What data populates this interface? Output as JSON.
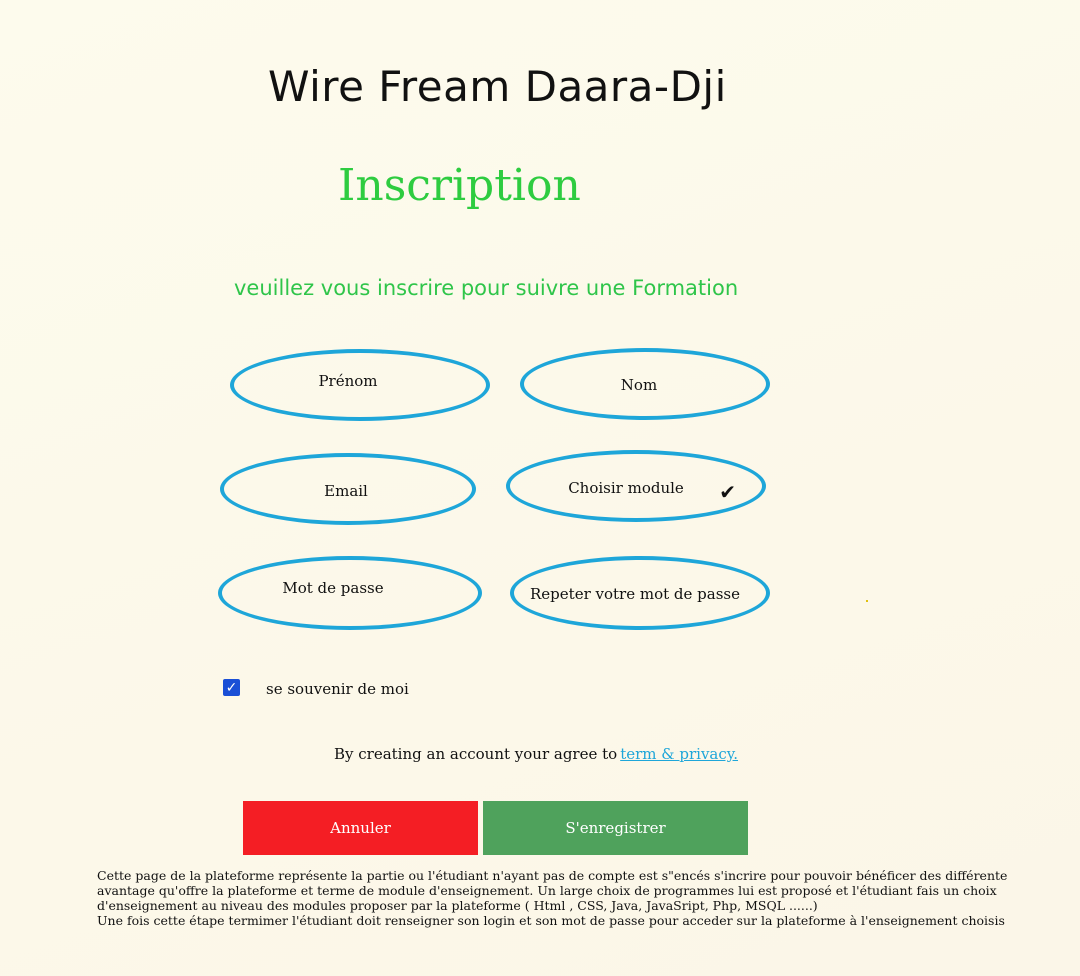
{
  "app_title": "Wire Fream Daara-Dji",
  "heading": "Inscription",
  "subtitle": "veuillez vous inscrire pour suivre une Formation",
  "fields": {
    "prenom": "Prénom",
    "nom": "Nom",
    "email": "Email",
    "module": "Choisir module",
    "password": "Mot de passe",
    "repeat_password": "Repeter votre mot de passe"
  },
  "module_icon": "checkmark-icon",
  "remember": {
    "label": "se souvenir de moi",
    "checked": true,
    "color": "#1a4fd6"
  },
  "terms": {
    "text": "By creating an account your agree to",
    "link": "term & privacy."
  },
  "buttons": {
    "cancel": "Annuler",
    "register": "S'enregistrer"
  },
  "colors": {
    "accent": "#1ea6d9",
    "heading": "#2ecc40",
    "cancel": "#f41e24",
    "register": "#4fa25c"
  },
  "description": {
    "line1": "Cette page de la plateforme représente la partie ou l'étudiant n'ayant pas de compte est s\"encés s'incrire pour pouvoir bénéficer des différente",
    "line2": "avantage qu'offre la plateforme et terme de module d'enseignement. Un large choix de programmes lui est proposé et l'étudiant  fais un choix",
    "line3": "d'enseignement au niveau des modules proposer par la plateforme ( Html , CSS, Java, JavaSript, Php, MSQL ......)",
    "line4": "Une fois cette étape termimer l'étudiant doit renseigner son login et son mot de passe pour acceder sur la plateforme à l'enseignement choisis"
  }
}
